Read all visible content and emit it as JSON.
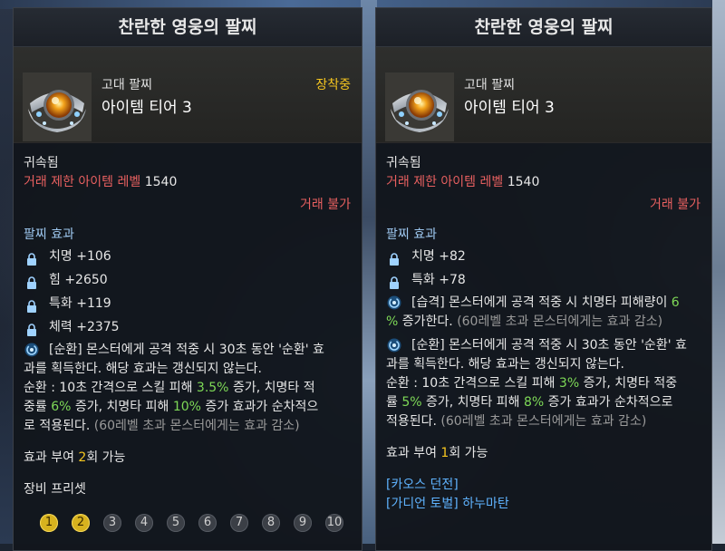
{
  "left_panel": {
    "title": "찬란한 영웅의 팔찌",
    "grade": "고대 팔찌",
    "tier": "아이템 티어 3",
    "equipped_label": "장착중",
    "bound": "귀속됨",
    "trade_level_label": "거래 제한 아이템 레벨",
    "trade_level_value": "1540",
    "trade_status": "거래 불가",
    "effects_header": "팔찌 효과",
    "stats": [
      {
        "text": "치명 +106"
      },
      {
        "text": "힘 +2650"
      },
      {
        "text": "특화 +119"
      },
      {
        "text": "체력 +2375"
      }
    ],
    "effect1": {
      "line1": "[순환] 몬스터에게 공격 적중 시 30초 동안 '순환' 효",
      "line2": "과를 획득한다. 해당 효과는 갱신되지 않는다.",
      "line3_a": "순환 : 10초 간격으로 스킬 피해 ",
      "line3_b": "3.5%",
      "line3_c": " 증가, 치명타 적",
      "line4_a": "중률 ",
      "line4_b": "6%",
      "line4_c": " 증가, 치명타 피해 ",
      "line4_d": "10%",
      "line4_e": " 증가 효과가 순차적으",
      "line5_a": "로 적용된다. ",
      "line5_b": "(60레벨 초과 몬스터에게는 효과 감소)"
    },
    "grant_a": "효과 부여 ",
    "grant_b": "2",
    "grant_c": "회 가능",
    "preset_label": "장비 프리셋",
    "presets": [
      "1",
      "2",
      "3",
      "4",
      "5",
      "6",
      "7",
      "8",
      "9",
      "10"
    ]
  },
  "right_panel": {
    "title": "찬란한 영웅의 팔찌",
    "grade": "고대 팔찌",
    "tier": "아이템 티어 3",
    "bound": "귀속됨",
    "trade_level_label": "거래 제한 아이템 레벨",
    "trade_level_value": "1540",
    "trade_status": "거래 불가",
    "effects_header": "팔찌 효과",
    "stats": [
      {
        "text": "치명 +82"
      },
      {
        "text": "특화 +78"
      }
    ],
    "effect1": {
      "line1_a": "[습격] 몬스터에게 공격 적중 시 치명타 피해량이 ",
      "line1_b": "6",
      "line2_a": "%",
      "line2_b": " 증가한다. ",
      "line2_c": "(60레벨 초과 몬스터에게는 효과 감소)"
    },
    "effect2": {
      "line1": "[순환] 몬스터에게 공격 적중 시 30초 동안 '순환' 효",
      "line2": "과를 획득한다. 해당 효과는 갱신되지 않는다.",
      "line3_a": "순환 : 10초 간격으로 스킬 피해 ",
      "line3_b": "3%",
      "line3_c": " 증가, 치명타 적중",
      "line4_a": "률 ",
      "line4_b": "5%",
      "line4_c": " 증가, 치명타 피해 ",
      "line4_d": "8%",
      "line4_e": " 증가 효과가 순차적으로",
      "line5_a": "적용된다. ",
      "line5_b": "(60레벨 초과 몬스터에게는 효과 감소)"
    },
    "grant_a": "효과 부여 ",
    "grant_b": "1",
    "grant_c": "회 가능",
    "links": [
      "[카오스 던전]",
      "[가디언 토벌] 하누마탄"
    ]
  },
  "colors": {
    "accent_yellow": "#f5c51f",
    "restriction_red": "#e86060",
    "value_green": "#7ed957",
    "section_blue": "#9ec8f0",
    "link_blue": "#5fb3ff"
  },
  "icons": {
    "stat_icon": "lock-icon",
    "effect_icon": "swirl-icon",
    "item_icon": "bracelet-icon"
  }
}
